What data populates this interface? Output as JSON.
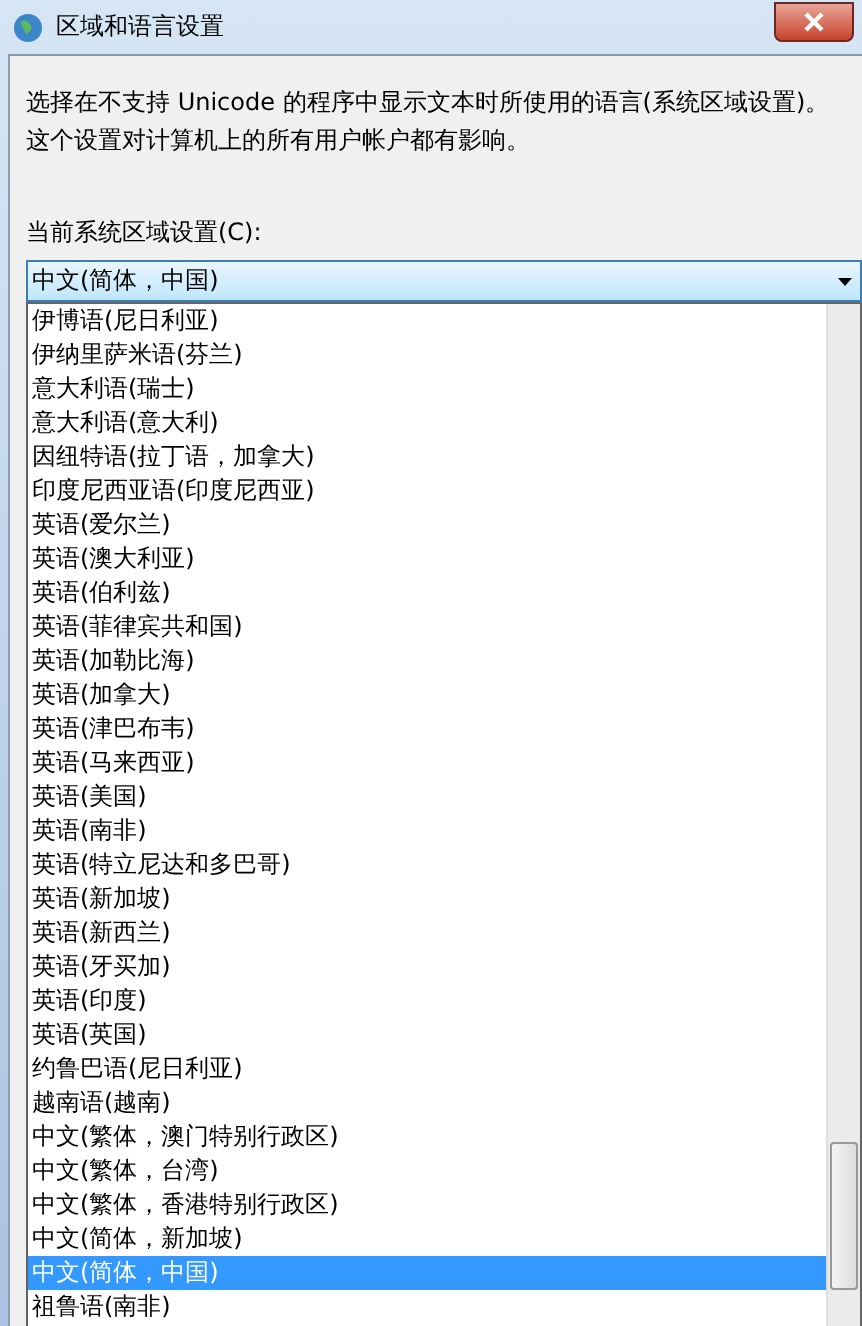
{
  "window": {
    "title": "区域和语言设置"
  },
  "description": "选择在不支持 Unicode 的程序中显示文本时所使用的语言(系统区域设置)。这个设置对计算机上的所有用户帐户都有影响。",
  "locale_label": "当前系统区域设置(C):",
  "locale_dropdown": {
    "value": "中文(简体，中国)",
    "expanded": true,
    "options": [
      {
        "label": "伊博语(尼日利亚)",
        "selected": false
      },
      {
        "label": "伊纳里萨米语(芬兰)",
        "selected": false
      },
      {
        "label": "意大利语(瑞士)",
        "selected": false
      },
      {
        "label": "意大利语(意大利)",
        "selected": false
      },
      {
        "label": "因纽特语(拉丁语，加拿大)",
        "selected": false
      },
      {
        "label": "印度尼西亚语(印度尼西亚)",
        "selected": false
      },
      {
        "label": "英语(爱尔兰)",
        "selected": false
      },
      {
        "label": "英语(澳大利亚)",
        "selected": false
      },
      {
        "label": "英语(伯利兹)",
        "selected": false
      },
      {
        "label": "英语(菲律宾共和国)",
        "selected": false
      },
      {
        "label": "英语(加勒比海)",
        "selected": false
      },
      {
        "label": "英语(加拿大)",
        "selected": false
      },
      {
        "label": "英语(津巴布韦)",
        "selected": false
      },
      {
        "label": "英语(马来西亚)",
        "selected": false
      },
      {
        "label": "英语(美国)",
        "selected": false
      },
      {
        "label": "英语(南非)",
        "selected": false
      },
      {
        "label": "英语(特立尼达和多巴哥)",
        "selected": false
      },
      {
        "label": "英语(新加坡)",
        "selected": false
      },
      {
        "label": "英语(新西兰)",
        "selected": false
      },
      {
        "label": "英语(牙买加)",
        "selected": false
      },
      {
        "label": "英语(印度)",
        "selected": false
      },
      {
        "label": "英语(英国)",
        "selected": false
      },
      {
        "label": "约鲁巴语(尼日利亚)",
        "selected": false
      },
      {
        "label": "越南语(越南)",
        "selected": false
      },
      {
        "label": "中文(繁体，澳门特别行政区)",
        "selected": false
      },
      {
        "label": "中文(繁体，台湾)",
        "selected": false
      },
      {
        "label": "中文(繁体，香港特别行政区)",
        "selected": false
      },
      {
        "label": "中文(简体，新加坡)",
        "selected": false
      },
      {
        "label": "中文(简体，中国)",
        "selected": true
      },
      {
        "label": "祖鲁语(南非)",
        "selected": false
      }
    ]
  }
}
